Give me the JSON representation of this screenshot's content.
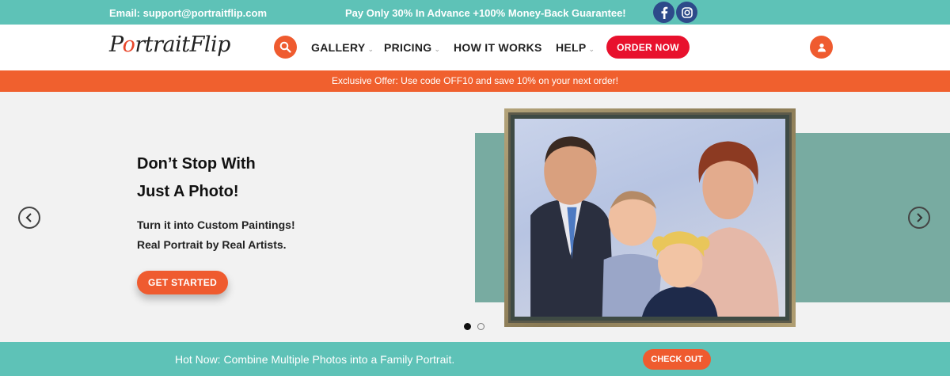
{
  "topbar": {
    "email": "Email: support@portraitflip.com",
    "promo": "Pay Only 30% In Advance +100% Money-Back Guarantee!",
    "social": {
      "facebook_icon": "f",
      "instagram_icon": "camera"
    }
  },
  "header": {
    "logo": {
      "part1": "P",
      "dot": "o",
      "part2": "rtraitFlip"
    },
    "nav": [
      {
        "label": "GALLERY",
        "has_dropdown": true
      },
      {
        "label": "PRICING",
        "has_dropdown": true
      },
      {
        "label": "HOW IT WORKS",
        "has_dropdown": false
      },
      {
        "label": "HELP",
        "has_dropdown": true
      }
    ],
    "chevron": "⌄",
    "order_label": "ORDER NOW"
  },
  "offer": {
    "text": "Exclusive Offer: Use code OFF10 and save 10% on your next order!"
  },
  "hero": {
    "title_line1": "Don’t Stop With",
    "title_line2": "Just A Photo!",
    "sub_line1": "Turn it into Custom Paintings!",
    "sub_line2": "Real Portrait by Real Artists.",
    "cta_label": "GET STARTED",
    "slide_count": 2,
    "active_slide": 1
  },
  "bottombar": {
    "message": "Hot Now: Combine Multiple Photos into a Family Portrait.",
    "cta_label": "CHECK OUT"
  },
  "colors": {
    "teal": "#5ec2b7",
    "orange": "#ef5b2f",
    "red": "#e8112d",
    "social": "#2d4a8a"
  }
}
